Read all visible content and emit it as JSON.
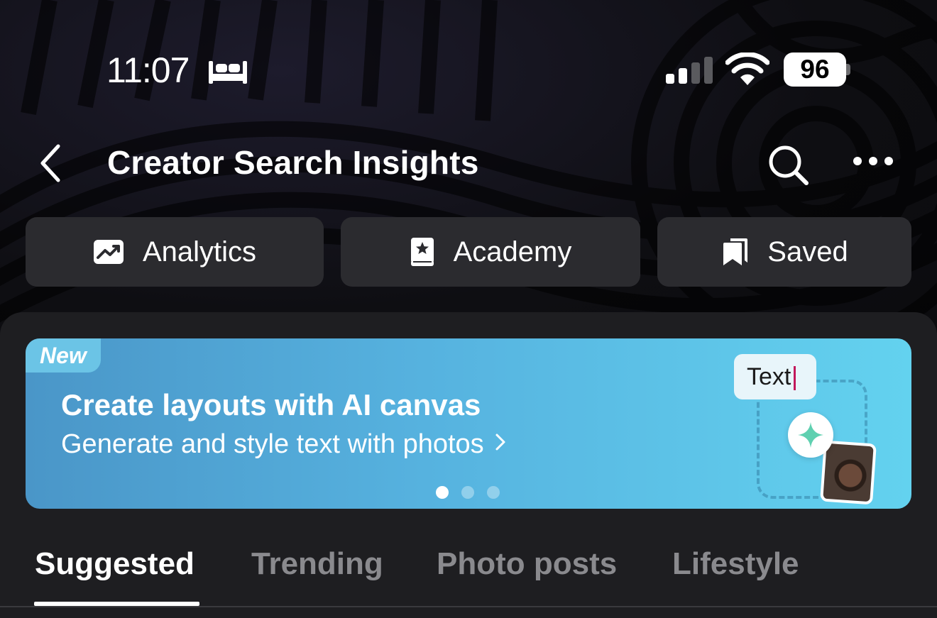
{
  "status_bar": {
    "time": "11:07",
    "battery_level": "96",
    "icons": [
      "sleep-bed-icon",
      "cellular-signal-icon",
      "wifi-icon",
      "battery-icon"
    ]
  },
  "header": {
    "title": "Creator Search Insights",
    "icons": [
      "back-chevron-icon",
      "search-icon",
      "more-options-icon"
    ]
  },
  "quick_actions": [
    {
      "label": "Analytics",
      "icon": "trend-chart-icon"
    },
    {
      "label": "Academy",
      "icon": "star-book-icon"
    },
    {
      "label": "Saved",
      "icon": "bookmarks-icon"
    }
  ],
  "banner": {
    "badge": "New",
    "title": "Create layouts with AI canvas",
    "subtitle": "Generate and style text with photos",
    "illustration_text": "Text",
    "page_count": 3,
    "active_page": 1
  },
  "tabs": [
    {
      "label": "Suggested",
      "active": true
    },
    {
      "label": "Trending",
      "active": false
    },
    {
      "label": "Photo posts",
      "active": false
    },
    {
      "label": "Lifestyle",
      "active": false
    }
  ],
  "colors": {
    "background": "#121214",
    "panel": "#1e1e21",
    "button": "#2b2b2f",
    "banner_start": "#4a96c8",
    "banner_end": "#63d2ef",
    "inactive_tab": "#8a8a8e",
    "sparkle": "#5fd0b0"
  }
}
